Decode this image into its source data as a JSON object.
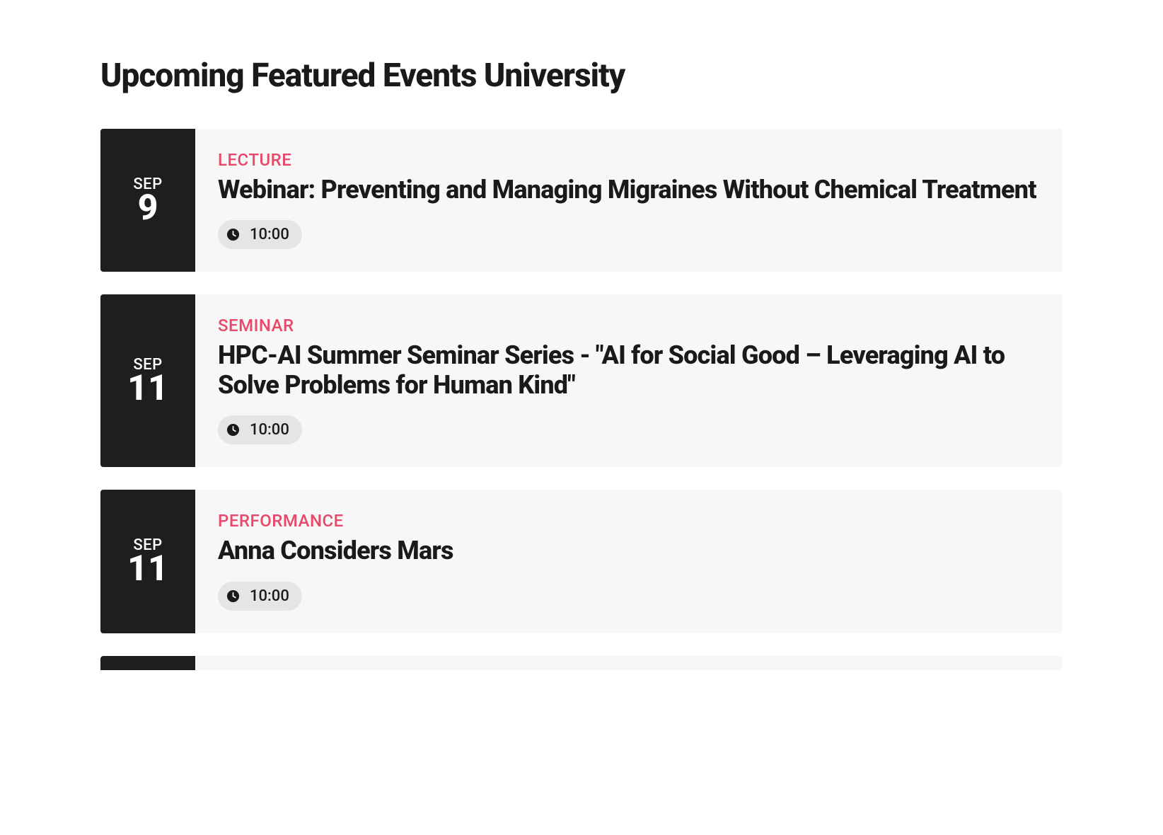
{
  "pageTitle": "Upcoming Featured Events University",
  "events": [
    {
      "month": "SEP",
      "day": "9",
      "category": "LECTURE",
      "title": "Webinar: Preventing and Managing Migraines Without Chemical Treatment",
      "time": "10:00"
    },
    {
      "month": "SEP",
      "day": "11",
      "category": "SEMINAR",
      "title": "HPC-AI Summer Seminar Series - \"AI for Social Good – Leveraging AI to Solve Problems for Human Kind\"",
      "time": "10:00"
    },
    {
      "month": "SEP",
      "day": "11",
      "category": "PERFORMANCE",
      "title": "Anna Considers Mars",
      "time": "10:00"
    }
  ]
}
